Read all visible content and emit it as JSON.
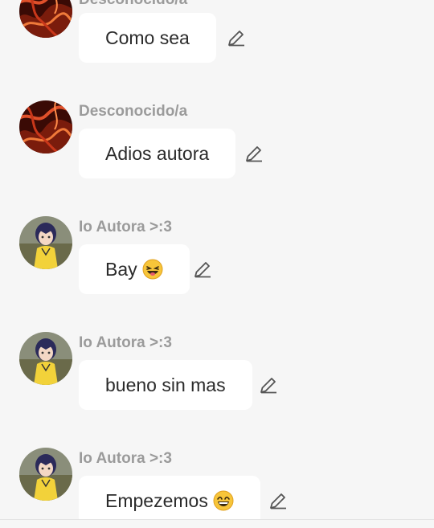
{
  "messages": [
    {
      "sender": "Desconocido/a",
      "avatar": "lava-avatar",
      "text": "Como sea",
      "emoji": null
    },
    {
      "sender": "Desconocido/a",
      "avatar": "lava-avatar",
      "text": "Adios autora",
      "emoji": null
    },
    {
      "sender": "Io Autora >:3",
      "avatar": "anime-girl-avatar",
      "text": "Bay",
      "emoji": "tongue-out-face"
    },
    {
      "sender": "Io Autora >:3",
      "avatar": "anime-girl-avatar",
      "text": "bueno sin mas",
      "emoji": null
    },
    {
      "sender": "Io Autora >:3",
      "avatar": "anime-girl-avatar",
      "text": "Empezemos",
      "emoji": "grinning-face"
    }
  ],
  "icons": {
    "edit": "pencil-icon"
  },
  "colors": {
    "background": "#f6f6f6",
    "bubble": "#ffffff",
    "sender": "#9b9b9b",
    "text": "#2b2b2b",
    "icon": "#555555"
  }
}
